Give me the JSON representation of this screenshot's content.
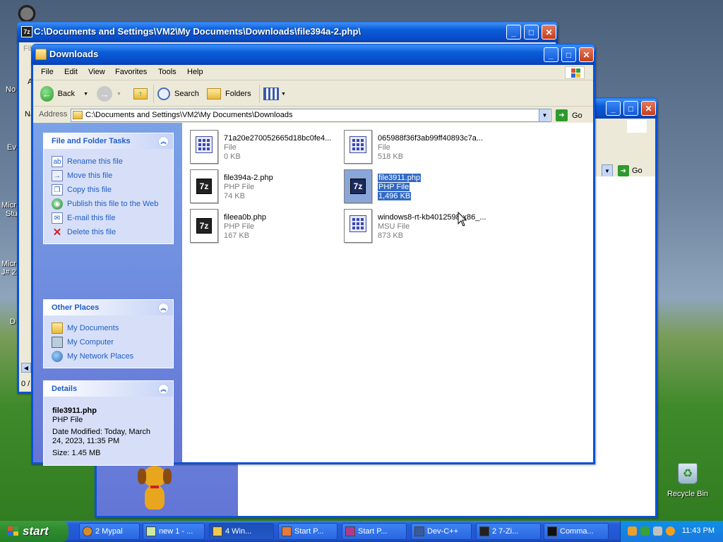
{
  "desktop": {
    "recycle_bin_label": "Recycle Bin",
    "left_edge_labels": [
      "No",
      "Ev",
      "Micr",
      "Stu",
      "Micr",
      "J# 2",
      "D"
    ]
  },
  "back_window": {
    "title": "C:\\Documents and Settings\\VM2\\My Documents\\Downloads\\file394a-2.php\\",
    "edge_texts": [
      "Fil",
      "A",
      "Na",
      "0 /"
    ]
  },
  "right_window": {
    "go_label": "Go"
  },
  "main_window": {
    "title": "Downloads",
    "menu": [
      "File",
      "Edit",
      "View",
      "Favorites",
      "Tools",
      "Help"
    ],
    "toolbar": {
      "back_label": "Back",
      "search_label": "Search",
      "folders_label": "Folders"
    },
    "address": {
      "label": "Address",
      "value": "C:\\Documents and Settings\\VM2\\My Documents\\Downloads",
      "go_label": "Go"
    },
    "file_tasks": {
      "title": "File and Folder Tasks",
      "items": [
        "Rename this file",
        "Move this file",
        "Copy this file",
        "Publish this file to the Web",
        "E-mail this file",
        "Delete this file"
      ]
    },
    "other_places": {
      "title": "Other Places",
      "items": [
        "My Documents",
        "My Computer",
        "My Network Places"
      ]
    },
    "details": {
      "title": "Details",
      "name": "file3911.php",
      "type": "PHP File",
      "modified_line1": "Date Modified: Today, March",
      "modified_line2": "24, 2023, 11:35 PM",
      "size": "Size: 1.45 MB"
    },
    "files": [
      {
        "name": "71a20e270052665d18bc0fe4...",
        "type": "File",
        "size": "0 KB",
        "icon": "generic-file-icon"
      },
      {
        "name": "065988f36f3ab99ff40893c7a...",
        "type": "File",
        "size": "518 KB",
        "icon": "generic-file-icon"
      },
      {
        "name": "file394a-2.php",
        "type": "PHP File",
        "size": "74 KB",
        "icon": "7zip-file-icon"
      },
      {
        "name": "file3911.php",
        "type": "PHP File",
        "size": "1,496 KB",
        "icon": "7zip-file-icon",
        "selected": true
      },
      {
        "name": "fileea0b.php",
        "type": "PHP File",
        "size": "167 KB",
        "icon": "7zip-file-icon"
      },
      {
        "name": "windows8-rt-kb4012598-x86_...",
        "type": "MSU File",
        "size": "873 KB",
        "icon": "generic-file-icon"
      }
    ]
  },
  "taskbar": {
    "start_label": "start",
    "items": [
      "2 Mypal",
      "new 1 - ...",
      "4 Win...",
      "Start P...",
      "Start P...",
      "Dev-C++",
      "2 7-Zi...",
      "Comma..."
    ],
    "clock": "11:43 PM"
  },
  "colors": {
    "titlebar": "#0a5ed9",
    "selection": "#316ac5",
    "taskbar": "#245edb",
    "start": "#2d8a2d",
    "task_link": "#215dc6"
  }
}
